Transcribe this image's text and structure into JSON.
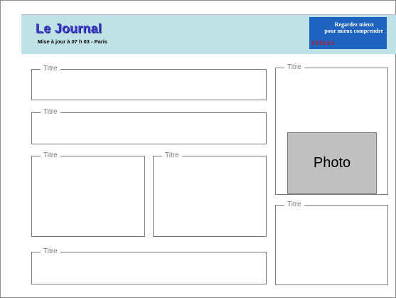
{
  "header": {
    "logo": "Le Journal",
    "update": "Mise à jour à 07 h 03 - Paris"
  },
  "ad": {
    "line1": "Regardez mieux",
    "line2": "pour mieux comprendre",
    "brand": "EYELSA"
  },
  "panels": [
    {
      "title": "Titre"
    },
    {
      "title": "Titre"
    },
    {
      "title": "Titre"
    },
    {
      "title": "Titre"
    },
    {
      "title": "Titre"
    },
    {
      "title": "Titre"
    },
    {
      "title": "Titre"
    }
  ],
  "photo": {
    "label": "Photo"
  }
}
